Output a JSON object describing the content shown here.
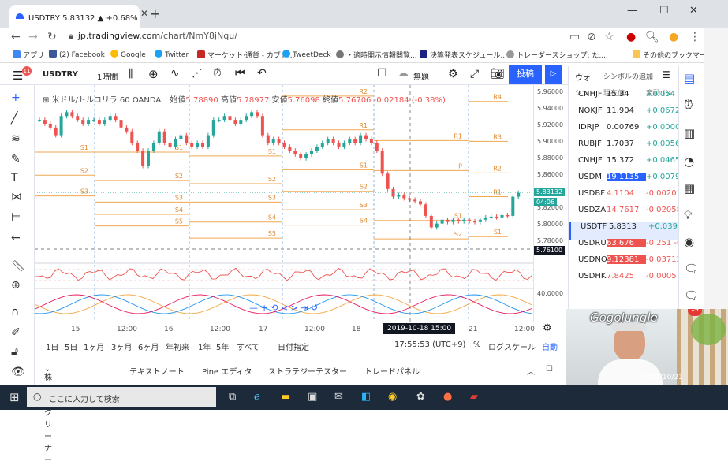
{
  "browser": {
    "tab_title": "USDTRY 5.83132 ▲ +0.68% 無題",
    "url_domain": "jp.tradingview.com",
    "url_path": "/chart/NmY8jNqu/",
    "bookmarks": [
      "アプリ",
      "(2) Facebook",
      "Google",
      "Twitter",
      "マーケット·通貨 - カブド...",
      "TweetDeck",
      "・適時開示情報閲覧...",
      "決算発表スケジュール...",
      "トレーダースショップ: た...",
      "その他のブックマーク"
    ]
  },
  "toolbar": {
    "symbol": "USDTRY",
    "interval": "1時間",
    "layout_name": "無題",
    "publish": "投稿"
  },
  "chart": {
    "legend_symbol": "米ドル/トルコリラ",
    "legend_interval": "60",
    "legend_exchange": "OANDA",
    "open_label": "始値",
    "open": "5.78890",
    "high_label": "高値",
    "high": "5.78977",
    "low_label": "安値",
    "low": "5.76098",
    "close_label": "終値",
    "close": "5.76706",
    "change": "-0.02184 (-0.38%)",
    "price_ticks": [
      "5.96000",
      "5.94000",
      "5.92000",
      "5.90000",
      "5.88000",
      "5.86000",
      "5.84000",
      "5.82000",
      "5.80000",
      "5.78000"
    ],
    "last_price": "5.83132",
    "countdown": "04:06",
    "cursor_price": "5.76100",
    "osc_tick": "40.0000",
    "time_ticks": [
      "15",
      "12:00",
      "16",
      "12:00",
      "17",
      "12:00",
      "18",
      "21",
      "12:00"
    ],
    "cursor_time": "2019-10-18 15:00",
    "pivot_labels": [
      "S1",
      "S2",
      "S3",
      "S4",
      "S5",
      "R1",
      "R2",
      "R3",
      "R4",
      "P"
    ]
  },
  "bottom": {
    "ranges": [
      "1日",
      "5日",
      "1ヶ月",
      "3ヶ月",
      "6ヶ月",
      "年初来",
      "1年",
      "5年",
      "すべて"
    ],
    "goto_date": "日付指定",
    "clock": "17:55:53 (UTC+9)",
    "percent": "%",
    "log": "ログスケール",
    "auto": "自動",
    "panels": [
      "株式スクリーナー",
      "テキストノート",
      "Pine エディタ",
      "ストラテジーテスター",
      "トレードパネル"
    ]
  },
  "watchlist": {
    "title": "ウォ",
    "add": "シンボルの追加",
    "cols": [
      "シン",
      "現在値",
      "変動 (%"
    ],
    "rows": [
      {
        "sym": "CNHJF",
        "last": "15.34",
        "chg": "+0.054 +0.3"
      },
      {
        "sym": "NOKJF",
        "last": "11.904",
        "chg": "+0.0672 +0.5"
      },
      {
        "sym": "IDRJP",
        "last": "0.00769",
        "chg": "+0.000052 +0.6"
      },
      {
        "sym": "RUBJF",
        "last": "1.7037",
        "chg": "+0.0056 +0.3"
      },
      {
        "sym": "CNHJF",
        "last": "15.372",
        "chg": "+0.0465 +0.3"
      },
      {
        "sym": "USDM",
        "last": "19.1135",
        "chg": "+0.00798 +0.0"
      },
      {
        "sym": "USDBF",
        "last": "4.1104",
        "chg": "-0.0020 -0.0"
      },
      {
        "sym": "USDZA",
        "last": "14.7617",
        "chg": "-0.02058 -0.1"
      },
      {
        "sym": "USDTF",
        "last": "5.8313",
        "chg": "+0.03920 +0.6"
      },
      {
        "sym": "USDRU",
        "last": "63.676",
        "chg": "-0.251 -0.39"
      },
      {
        "sym": "USDNO",
        "last": "9.12381",
        "chg": "-0.03712 -0.4"
      },
      {
        "sym": "USDHK",
        "last": "7.8425",
        "chg": "-0.00057 -0.0"
      }
    ]
  },
  "webcam": {
    "logo": "GogoJungle",
    "date": "2019/10/21",
    "badge": "14"
  },
  "taskbar": {
    "search": "ここに入力して検索"
  },
  "notif": "11",
  "colors": {
    "up": "#26a69a",
    "down": "#ef5350",
    "pivot": "#f0a850",
    "accent": "#2962ff"
  }
}
